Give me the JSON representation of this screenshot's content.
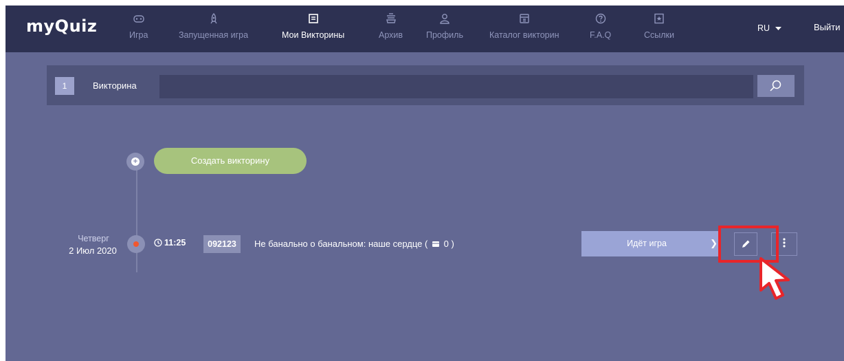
{
  "header": {
    "logo_prefix": "my",
    "logo_q": "Q",
    "logo_suffix": "uiz",
    "nav": [
      {
        "label": "Игра",
        "icon": "gamepad-icon"
      },
      {
        "label": "Запущенная игра",
        "icon": "rocket-icon"
      },
      {
        "label": "Мои Викторины",
        "icon": "quiz-list-icon",
        "active": true
      },
      {
        "label": "Архив",
        "icon": "archive-icon"
      },
      {
        "label": "Профиль",
        "icon": "user-icon"
      },
      {
        "label": "Каталог викторин",
        "icon": "catalog-icon"
      },
      {
        "label": "F.A.Q",
        "icon": "question-icon"
      },
      {
        "label": "Ссылки",
        "icon": "bookmark-icon"
      }
    ],
    "lang": "RU",
    "logout": "Выйти"
  },
  "search": {
    "number": "1",
    "label": "Викторина",
    "value": ""
  },
  "timeline": {
    "create_label": "Создать викторину",
    "items": [
      {
        "day": "Четверг",
        "date": "2 Июл 2020",
        "time": "11:25",
        "code": "092123",
        "title_main": "Не банально о банальном: наше сердце (",
        "title_count": "0 )",
        "status": "Идёт игра"
      }
    ]
  },
  "colors": {
    "background": "#636893",
    "topbar": "#2d3152",
    "create_button": "#a7c37d",
    "status_button": "#9aa4d6",
    "live_dot": "#f1572e",
    "highlight": "#e8252a"
  }
}
